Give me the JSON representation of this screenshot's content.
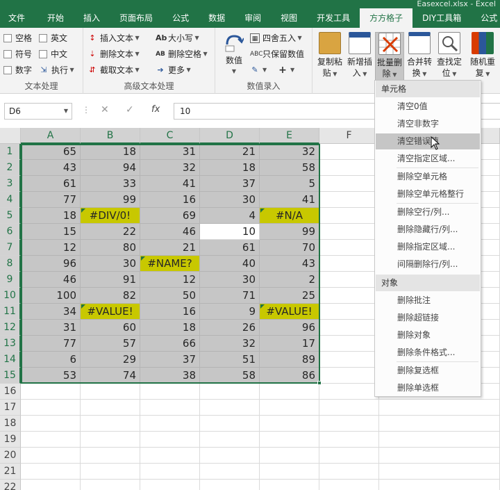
{
  "window": {
    "title": "Easexcel.xlsx - Excel"
  },
  "tabs": [
    "文件",
    "开始",
    "插入",
    "页面布局",
    "公式",
    "数据",
    "审阅",
    "视图",
    "开发工具",
    "方方格子",
    "DIY工具箱",
    "公式"
  ],
  "ribbon": {
    "text_group": {
      "label": "文本处理",
      "items": [
        "空格",
        "英文",
        "符号",
        "中文",
        "数字",
        "执行"
      ]
    },
    "adv_group": {
      "label": "高级文本处理",
      "items": [
        "插入文本",
        "删除文本",
        "截取文本",
        "大小写",
        "删除空格",
        "更多"
      ]
    },
    "num_group": {
      "label": "数值录入",
      "big": "数值",
      "items": [
        "四舍五入",
        "只保留数值"
      ]
    },
    "big_buttons": [
      {
        "l1": "复制粘",
        "l2": "贴"
      },
      {
        "l1": "新增插",
        "l2": "入"
      },
      {
        "l1": "批量删",
        "l2": "除"
      },
      {
        "l1": "合并转",
        "l2": "换"
      },
      {
        "l1": "查找定",
        "l2": "位"
      },
      {
        "l1": "随机重",
        "l2": "复"
      }
    ]
  },
  "formula_bar": {
    "name_box": "D6",
    "fx": "fx",
    "value": "10"
  },
  "columns": [
    "A",
    "B",
    "C",
    "D",
    "E",
    "F"
  ],
  "rows": [
    "1",
    "2",
    "3",
    "4",
    "5",
    "6",
    "7",
    "8",
    "9",
    "10",
    "11",
    "12",
    "13",
    "14",
    "15",
    "16",
    "17",
    "18",
    "19",
    "20",
    "21",
    "22"
  ],
  "cells": [
    [
      "65",
      "18",
      "31",
      "21",
      "32"
    ],
    [
      "43",
      "94",
      "32",
      "18",
      "58"
    ],
    [
      "61",
      "33",
      "41",
      "37",
      "5"
    ],
    [
      "77",
      "99",
      "16",
      "30",
      "41"
    ],
    [
      "18",
      "#DIV/0!",
      "69",
      "4",
      "#N/A"
    ],
    [
      "15",
      "22",
      "46",
      "10",
      "99"
    ],
    [
      "12",
      "80",
      "21",
      "61",
      "70"
    ],
    [
      "96",
      "30",
      "#NAME?",
      "40",
      "43"
    ],
    [
      "46",
      "91",
      "12",
      "30",
      "2"
    ],
    [
      "100",
      "82",
      "50",
      "71",
      "25"
    ],
    [
      "34",
      "#VALUE!",
      "16",
      "9",
      "#VALUE!"
    ],
    [
      "31",
      "60",
      "18",
      "26",
      "96"
    ],
    [
      "77",
      "57",
      "66",
      "32",
      "17"
    ],
    [
      "6",
      "29",
      "37",
      "51",
      "89"
    ],
    [
      "53",
      "74",
      "38",
      "58",
      "86"
    ]
  ],
  "menu": {
    "section1": "单元格",
    "items1": [
      "清空0值",
      "清空非数字",
      "清空错误值",
      "清空指定区域...",
      "删除空单元格",
      "删除空单元格整行",
      "删除空行/列...",
      "删除隐藏行/列...",
      "删除指定区域...",
      "间隔删除行/列..."
    ],
    "section2": "对象",
    "items2": [
      "删除批注",
      "删除超链接",
      "删除对象",
      "删除条件格式...",
      "删除复选框",
      "删除单选框"
    ],
    "highlighted": "清空错误值"
  },
  "colors": {
    "excel_green": "#217346",
    "selection_gray": "#c6c6c6",
    "error_yellow": "#c8c800"
  }
}
